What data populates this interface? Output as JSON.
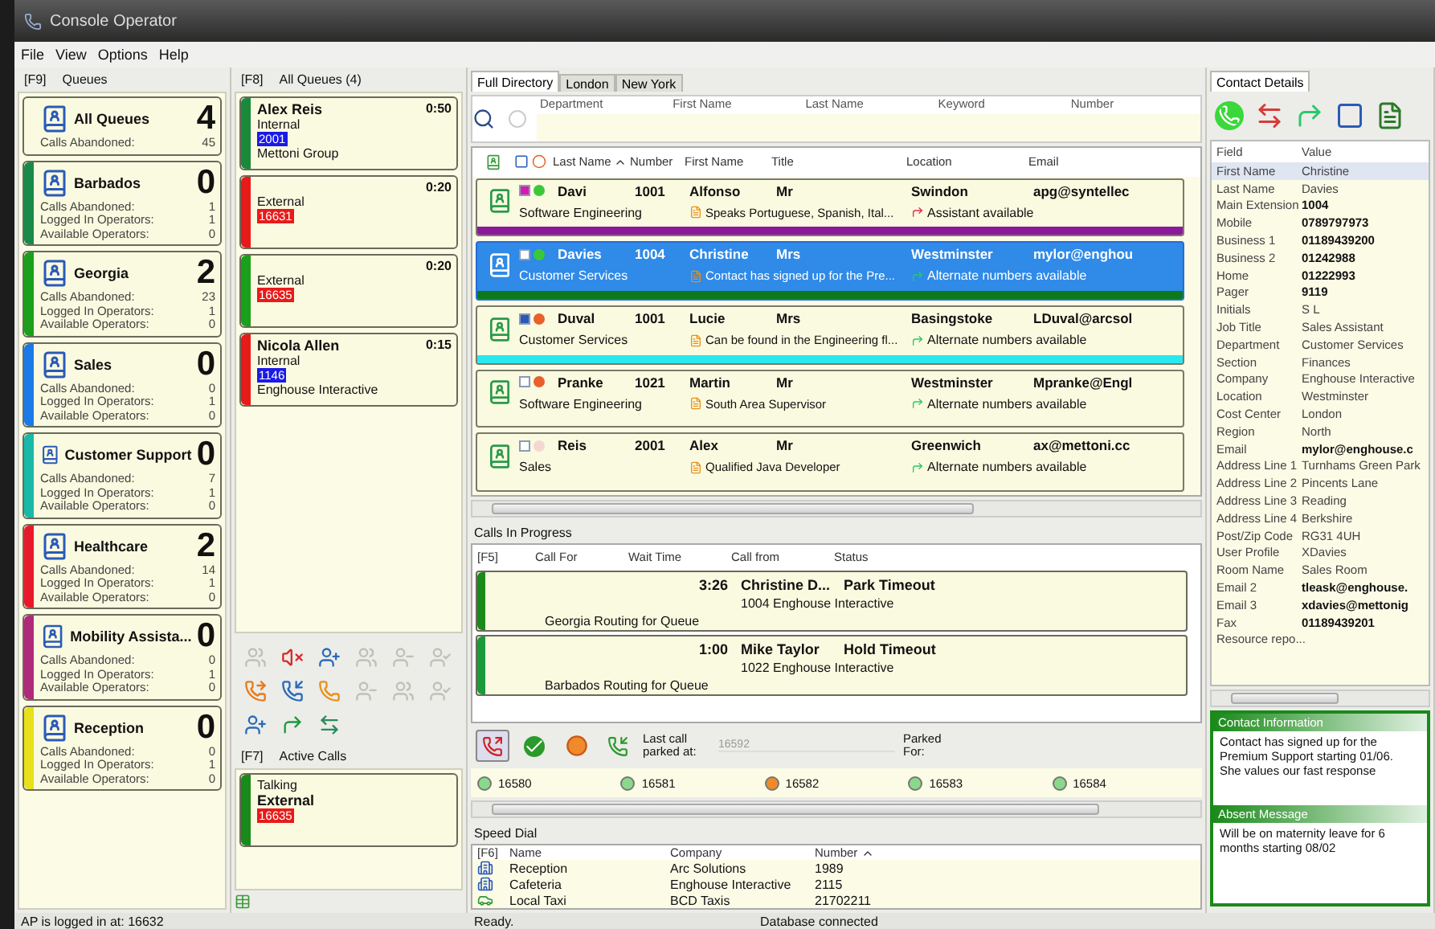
{
  "window": {
    "title": "Console Operator"
  },
  "menu": [
    "File",
    "View",
    "Options",
    "Help"
  ],
  "queues_panel": {
    "hotkey": "[F9]",
    "title": "Queues",
    "queues": [
      {
        "name": "All Queues",
        "count": "4",
        "stats": [
          {
            "label": "Calls Abandoned:",
            "value": "45"
          }
        ]
      },
      {
        "name": "Barbados",
        "count": "0",
        "color": "#1a8a4a",
        "stats": [
          {
            "label": "Calls Abandoned:",
            "value": "1"
          },
          {
            "label": "Logged In Operators:",
            "value": "1"
          },
          {
            "label": "Available Operators:",
            "value": "0"
          }
        ]
      },
      {
        "name": "Georgia",
        "count": "2",
        "color": "#1aa01a",
        "stats": [
          {
            "label": "Calls Abandoned:",
            "value": "23"
          },
          {
            "label": "Logged In Operators:",
            "value": "1"
          },
          {
            "label": "Available Operators:",
            "value": "0"
          }
        ]
      },
      {
        "name": "Sales",
        "count": "0",
        "color": "#1a7ae8",
        "stats": [
          {
            "label": "Calls Abandoned:",
            "value": "0"
          },
          {
            "label": "Logged In Operators:",
            "value": "1"
          },
          {
            "label": "Available Operators:",
            "value": "0"
          }
        ]
      },
      {
        "name": "Customer Support",
        "count": "0",
        "color": "#1ab8a8",
        "stats": [
          {
            "label": "Calls Abandoned:",
            "value": "7"
          },
          {
            "label": "Logged In Operators:",
            "value": "1"
          },
          {
            "label": "Available Operators:",
            "value": "0"
          }
        ]
      },
      {
        "name": "Healthcare",
        "count": "2",
        "color": "#e81a2a",
        "stats": [
          {
            "label": "Calls Abandoned:",
            "value": "14"
          },
          {
            "label": "Logged In Operators:",
            "value": "1"
          },
          {
            "label": "Available Operators:",
            "value": "0"
          }
        ]
      },
      {
        "name": "Mobility Assista...",
        "count": "0",
        "color": "#b02a7a",
        "stats": [
          {
            "label": "Calls Abandoned:",
            "value": "0"
          },
          {
            "label": "Logged In Operators:",
            "value": "1"
          },
          {
            "label": "Available Operators:",
            "value": "0"
          }
        ]
      },
      {
        "name": "Reception",
        "count": "0",
        "color": "#e8e01a",
        "stats": [
          {
            "label": "Calls Abandoned:",
            "value": "0"
          },
          {
            "label": "Logged In Operators:",
            "value": "1"
          },
          {
            "label": "Available Operators:",
            "value": "0"
          }
        ]
      }
    ]
  },
  "calls_panel": {
    "hotkey": "[F8]",
    "title": "All Queues (4)",
    "calls": [
      {
        "name": "Alex Reis",
        "time": "0:50",
        "type": "Internal",
        "number": "2001",
        "internal": true,
        "company": "Mettoni Group",
        "color": "#1a8a3a"
      },
      {
        "time": "0:20",
        "type": "External",
        "number": "16631",
        "internal": false,
        "color": "#e81a1a"
      },
      {
        "time": "0:20",
        "type": "External",
        "number": "16635",
        "internal": false,
        "color": "#1aa01a"
      },
      {
        "name": "Nicola Allen",
        "time": "0:15",
        "type": "Internal",
        "number": "1146",
        "internal": true,
        "company": "Enghouse Interactive",
        "color": "#e81a1a"
      }
    ]
  },
  "call_toolbar": [
    {
      "disabled": true
    },
    {
      "disabled": false
    },
    {
      "disabled": false
    },
    {
      "disabled": true
    },
    {
      "disabled": true
    },
    {
      "disabled": true
    },
    {
      "disabled": false
    },
    {
      "disabled": false
    },
    {
      "disabled": false
    },
    {
      "disabled": true
    },
    {
      "disabled": true
    },
    {
      "disabled": true
    },
    {
      "disabled": false
    },
    {
      "disabled": false
    },
    {
      "disabled": false
    }
  ],
  "active_calls": {
    "hotkey": "[F7]",
    "title": "Active Calls",
    "calls": [
      {
        "status": "Talking",
        "type": "External",
        "number": "16635",
        "internal": false,
        "color": "#1a8a1a"
      }
    ]
  },
  "directory": {
    "tabs": [
      {
        "label": "Full Directory",
        "selected": true
      },
      {
        "label": "London",
        "selected": false
      },
      {
        "label": "New York",
        "selected": false
      }
    ],
    "search_fields": [
      "Department",
      "First Name",
      "Last Name",
      "Keyword",
      "Number"
    ],
    "columns": [
      "Last Name",
      "Number",
      "First Name",
      "Title",
      "Location",
      "Email"
    ],
    "rows": [
      {
        "last_name": "Davi",
        "number": "1001",
        "first_name": "Alfonso",
        "title": "Mr",
        "location": "Swindon",
        "email": "apg@syntellec",
        "department": "Software Engineering",
        "note": "Speaks Portuguese, Spanish, Ital...",
        "availability": "Assistant available",
        "presence": {
          "color": "#3ac83a"
        },
        "label": {
          "color": "#d81ab0"
        },
        "color": "#8a1a9a",
        "selected": false
      },
      {
        "last_name": "Davies",
        "number": "1004",
        "first_name": "Christine",
        "title": "Mrs",
        "location": "Westminster",
        "email": "mylor@enghou",
        "department": "Customer Services",
        "note": "Contact has signed up for the Pre...",
        "availability": "Alternate numbers available",
        "presence": {
          "color": "#3ac83a"
        },
        "color": "#0a7a1a",
        "selected": true
      },
      {
        "last_name": "Duval",
        "number": "1001",
        "first_name": "Lucie",
        "title": "Mrs",
        "location": "Basingstoke",
        "email": "LDuval@arcsol",
        "department": "Customer Services",
        "note": "Can be found in the Engineering fl...",
        "availability": "Alternate numbers available",
        "presence": {
          "color": "#e8602a"
        },
        "label": {
          "color": "#2a5ab8"
        },
        "color": "#2ae8f0",
        "selected": false
      },
      {
        "last_name": "Pranke",
        "number": "1021",
        "first_name": "Martin",
        "title": "Mr",
        "location": "Westminster",
        "email": "Mpranke@Engl",
        "department": "Software Engineering",
        "note": "South Area Supervisor",
        "availability": "Alternate numbers available",
        "presence": {
          "color": "#e8602a"
        },
        "selected": false
      },
      {
        "last_name": "Reis",
        "number": "2001",
        "first_name": "Alex",
        "title": "Mr",
        "location": "Greenwich",
        "email": "ax@mettoni.cc",
        "department": "Sales",
        "note": "Qualified Java Developer",
        "availability": "Alternate numbers available",
        "presence": {
          "color": "#f4d8d0"
        },
        "selected": false
      }
    ]
  },
  "calls_in_progress": {
    "title": "Calls In Progress",
    "hotkey": "[F5]",
    "columns": [
      "Call For",
      "Wait Time",
      "Call from",
      "Status"
    ],
    "calls": [
      {
        "wait": "3:26",
        "caller": "Christine D...",
        "status": "Park Timeout",
        "caller_detail": "1004 Enghouse Interactive",
        "routing": "Georgia Routing for Queue",
        "color": "#1a8a1a"
      },
      {
        "wait": "1:00",
        "caller": "Mike Taylor",
        "status": "Hold Timeout",
        "caller_detail": "1022 Enghouse Interactive",
        "routing": "Barbados Routing for Queue",
        "color": "#1a9a3a"
      }
    ]
  },
  "parking": {
    "last_parked_label": "Last call parked at:",
    "last_parked": "16592",
    "parked_for_label": "Parked For:",
    "slots": [
      {
        "number": "16580",
        "busy": false
      },
      {
        "number": "16581",
        "busy": false
      },
      {
        "number": "16582",
        "busy": true
      },
      {
        "number": "16583",
        "busy": false
      },
      {
        "number": "16584",
        "busy": false
      }
    ]
  },
  "speed_dial": {
    "title": "Speed Dial",
    "hotkey": "[F6]",
    "columns": [
      "Name",
      "Company",
      "Number"
    ],
    "entries": [
      {
        "name": "Reception",
        "company": "Arc Solutions",
        "number": "1989",
        "kind": "internal"
      },
      {
        "name": "Cafeteria",
        "company": "Enghouse Interactive",
        "number": "2115",
        "kind": "internal"
      },
      {
        "name": "Local Taxi",
        "company": "BCD Taxis",
        "number": "21702211",
        "kind": "external"
      }
    ]
  },
  "contact": {
    "tab": "Contact Details",
    "columns": [
      "Field",
      "Value"
    ],
    "fields": [
      {
        "field": "First Name",
        "value": "Christine",
        "bold": false,
        "selected": true
      },
      {
        "field": "Last Name",
        "value": "Davies",
        "bold": false,
        "selected": false
      },
      {
        "field": "Main Extension",
        "value": "1004",
        "bold": true,
        "selected": false
      },
      {
        "field": "Mobile",
        "value": "0789797973",
        "bold": true,
        "selected": false
      },
      {
        "field": "Business 1",
        "value": "01189439200",
        "bold": true,
        "selected": false
      },
      {
        "field": "Business 2",
        "value": "01242988",
        "bold": true,
        "selected": false
      },
      {
        "field": "Home",
        "value": "01222993",
        "bold": true,
        "selected": false
      },
      {
        "field": "Pager",
        "value": "9119",
        "bold": true,
        "selected": false
      },
      {
        "field": "Initials",
        "value": "S L",
        "bold": false,
        "selected": false
      },
      {
        "field": "Job Title",
        "value": "Sales Assistant",
        "bold": false,
        "selected": false
      },
      {
        "field": "Department",
        "value": "Customer Services",
        "bold": false,
        "selected": false
      },
      {
        "field": "Section",
        "value": "Finances",
        "bold": false,
        "selected": false
      },
      {
        "field": "Company",
        "value": "Enghouse Interactive",
        "bold": false,
        "selected": false
      },
      {
        "field": "Location",
        "value": "Westminster",
        "bold": false,
        "selected": false
      },
      {
        "field": "Cost Center",
        "value": "London",
        "bold": false,
        "selected": false
      },
      {
        "field": "Region",
        "value": "North",
        "bold": false,
        "selected": false
      },
      {
        "field": "Email",
        "value": "mylor@enghouse.c",
        "bold": true,
        "selected": false
      },
      {
        "field": "Address Line 1",
        "value": "Turnhams Green Park",
        "bold": false,
        "selected": false
      },
      {
        "field": "Address Line 2",
        "value": "Pincents Lane",
        "bold": false,
        "selected": false
      },
      {
        "field": "Address Line 3",
        "value": "Reading",
        "bold": false,
        "selected": false
      },
      {
        "field": "Address Line 4",
        "value": "Berkshire",
        "bold": false,
        "selected": false
      },
      {
        "field": "Post/Zip Code",
        "value": "RG31 4UH",
        "bold": false,
        "selected": false
      },
      {
        "field": "User Profile",
        "value": "XDavies",
        "bold": false,
        "selected": false
      },
      {
        "field": "Room Name",
        "value": "Sales Room",
        "bold": false,
        "selected": false
      },
      {
        "field": "Email 2",
        "value": "tleask@enghouse.",
        "bold": true,
        "selected": false
      },
      {
        "field": "Email 3",
        "value": "xdavies@mettonig",
        "bold": true,
        "selected": false
      },
      {
        "field": "Fax",
        "value": "01189439201",
        "bold": true,
        "selected": false
      },
      {
        "field": "Resource repo..."
      }
    ],
    "info_title": "Contact Information",
    "info": "Contact has signed up for the Premium Support starting 01/06. She values our fast response",
    "absent_title": "Absent Message",
    "absent": "Will be on maternity leave for 6 months starting 08/02"
  },
  "status_bar": [
    "AP is logged in at: 16632",
    "Ready.",
    "Database connected"
  ]
}
